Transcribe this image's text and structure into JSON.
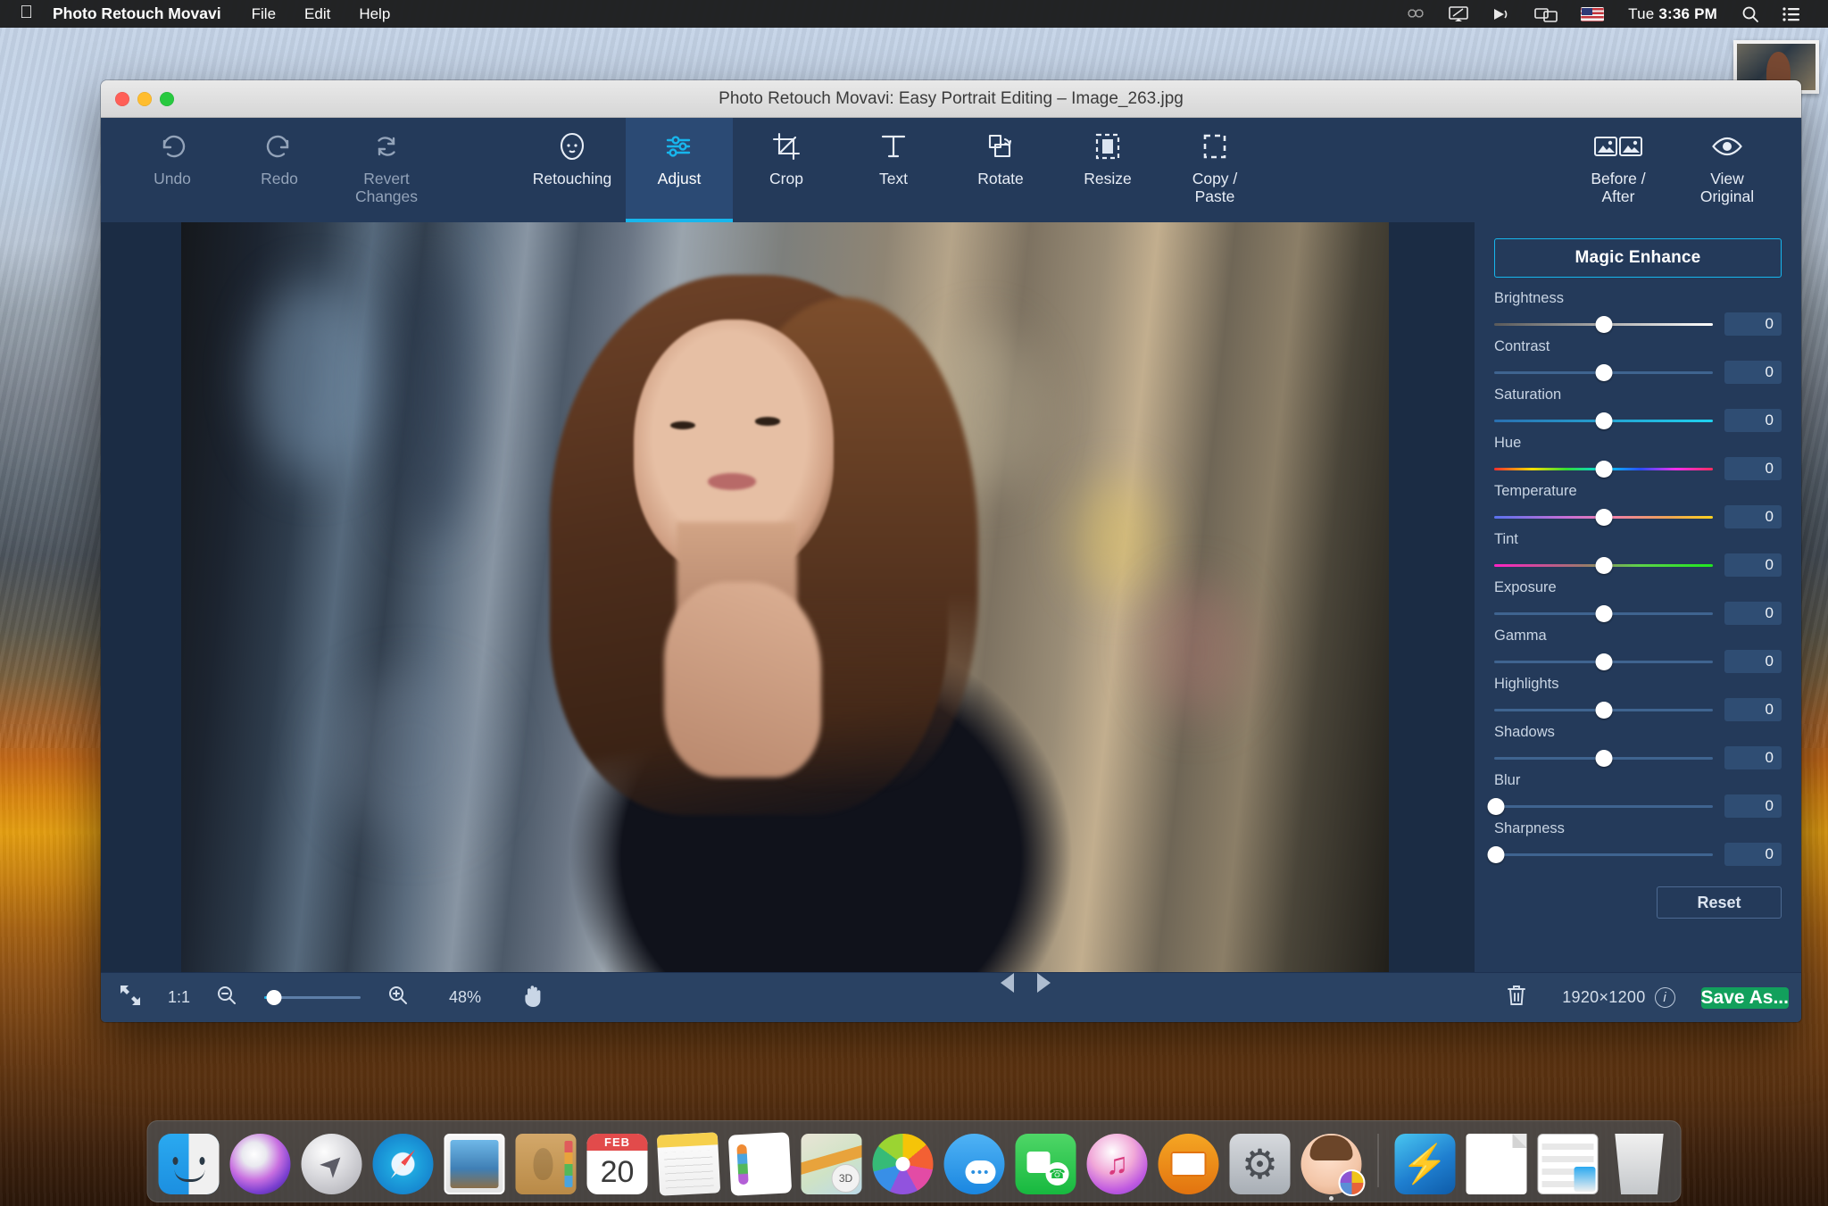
{
  "menubar": {
    "apple_glyph": "⌘",
    "app_name": "Photo Retouch Movavi",
    "items": [
      "File",
      "Edit",
      "Help"
    ],
    "status_icons": [
      "creative-cloud-icon",
      "airplay-display-icon",
      "voiceover-icon",
      "screen-mirroring-icon",
      "us-flag-icon"
    ],
    "clock_day": "Tue",
    "clock_time": "3:36 PM",
    "search_glyph": "⌕",
    "control_center_glyph": "☰"
  },
  "window": {
    "title": "Photo Retouch Movavi: Easy Portrait Editing – Image_263.jpg"
  },
  "toolbar": {
    "left": [
      {
        "label": "Undo",
        "icon": "undo-arrow-icon",
        "state": "disabled"
      },
      {
        "label": "Redo",
        "icon": "redo-arrow-icon",
        "state": "disabled"
      },
      {
        "label": "Revert\nChanges",
        "label_line1": "Revert",
        "label_line2": "Changes",
        "icon": "revert-circular-arrows-icon",
        "state": "disabled"
      }
    ],
    "middle": [
      {
        "label": "Retouching",
        "icon": "face-retouch-icon",
        "active": false
      },
      {
        "label": "Adjust",
        "icon": "sliders-icon",
        "active": true
      },
      {
        "label": "Crop",
        "icon": "crop-icon",
        "active": false
      },
      {
        "label": "Text",
        "icon": "text-t-icon",
        "active": false
      },
      {
        "label": "Rotate",
        "icon": "rotate-icon",
        "active": false
      },
      {
        "label": "Resize",
        "icon": "resize-icon",
        "active": false
      },
      {
        "label": "Copy /\nPaste",
        "label_line1": "Copy /",
        "label_line2": "Paste",
        "icon": "marquee-select-icon",
        "active": false
      }
    ],
    "right": [
      {
        "label_line1": "Before /",
        "label_line2": "After",
        "icon": "before-after-icon"
      },
      {
        "label_line1": "View",
        "label_line2": "Original",
        "icon": "eye-icon"
      }
    ]
  },
  "panel": {
    "magic_enhance_label": "Magic Enhance",
    "reset_label": "Reset",
    "sliders": [
      {
        "label": "Brightness",
        "value": "0",
        "knob_pct": 50,
        "bar": "bright"
      },
      {
        "label": "Contrast",
        "value": "0",
        "knob_pct": 50,
        "bar": "plain"
      },
      {
        "label": "Saturation",
        "value": "0",
        "knob_pct": 50,
        "bar": "sat"
      },
      {
        "label": "Hue",
        "value": "0",
        "knob_pct": 50,
        "bar": "hue"
      },
      {
        "label": "Temperature",
        "value": "0",
        "knob_pct": 50,
        "bar": "temp"
      },
      {
        "label": "Tint",
        "value": "0",
        "knob_pct": 50,
        "bar": "tint"
      },
      {
        "label": "Exposure",
        "value": "0",
        "knob_pct": 50,
        "bar": "plain"
      },
      {
        "label": "Gamma",
        "value": "0",
        "knob_pct": 50,
        "bar": "plain"
      },
      {
        "label": "Highlights",
        "value": "0",
        "knob_pct": 50,
        "bar": "plain"
      },
      {
        "label": "Shadows",
        "value": "0",
        "knob_pct": 50,
        "bar": "plain"
      },
      {
        "label": "Blur",
        "value": "0",
        "knob_pct": 1,
        "bar": "plain"
      },
      {
        "label": "Sharpness",
        "value": "0",
        "knob_pct": 1,
        "bar": "plain"
      }
    ]
  },
  "bottombar": {
    "fit_icon": "fit-to-screen-icon",
    "actual_size_label": "1:1",
    "zoom_out_icon": "zoom-out-icon",
    "zoom_in_icon": "zoom-in-icon",
    "zoom_percent": "48%",
    "zoom_knob_pct": 10,
    "hand_icon": "hand-pan-icon",
    "prev_icon": "previous-arrow-icon",
    "next_icon": "next-arrow-icon",
    "delete_icon": "trash-icon",
    "dimensions": "1920×1200",
    "info_icon": "info-icon",
    "save_label": "Save As..."
  },
  "dock": {
    "items": [
      {
        "name": "Finder",
        "cls": "d-finder",
        "running": true
      },
      {
        "name": "Siri",
        "cls": "d-siri",
        "running": false
      },
      {
        "name": "Launchpad",
        "cls": "d-launch",
        "running": false
      },
      {
        "name": "Safari",
        "cls": "d-safari",
        "running": false
      },
      {
        "name": "Mail",
        "cls": "d-mail",
        "running": false
      },
      {
        "name": "Contacts",
        "cls": "d-contacts",
        "running": false
      },
      {
        "name": "Calendar",
        "cls": "d-calendar",
        "running": false,
        "month": "FEB",
        "day": "20"
      },
      {
        "name": "Notes",
        "cls": "d-notes",
        "running": false
      },
      {
        "name": "Reminders",
        "cls": "d-reminders",
        "running": false
      },
      {
        "name": "Maps",
        "cls": "d-maps",
        "running": false
      },
      {
        "name": "Photos",
        "cls": "d-photos",
        "running": false
      },
      {
        "name": "Messages",
        "cls": "d-messages",
        "running": false
      },
      {
        "name": "FaceTime",
        "cls": "d-facetime",
        "running": false
      },
      {
        "name": "iTunes",
        "cls": "d-itunes",
        "running": false
      },
      {
        "name": "iBooks",
        "cls": "d-ibooks",
        "running": false
      },
      {
        "name": "System Preferences",
        "cls": "d-syspref",
        "running": false
      },
      {
        "name": "Photo Retouch Movavi",
        "cls": "d-movavi",
        "running": true
      }
    ],
    "items2": [
      {
        "name": "Power Downloader",
        "cls": "d-power",
        "running": false
      },
      {
        "name": "Document",
        "cls": "d-doc",
        "running": false
      },
      {
        "name": "Downloads Stack",
        "cls": "d-downloads",
        "running": false
      },
      {
        "name": "Trash",
        "cls": "d-trash",
        "running": false
      }
    ]
  }
}
